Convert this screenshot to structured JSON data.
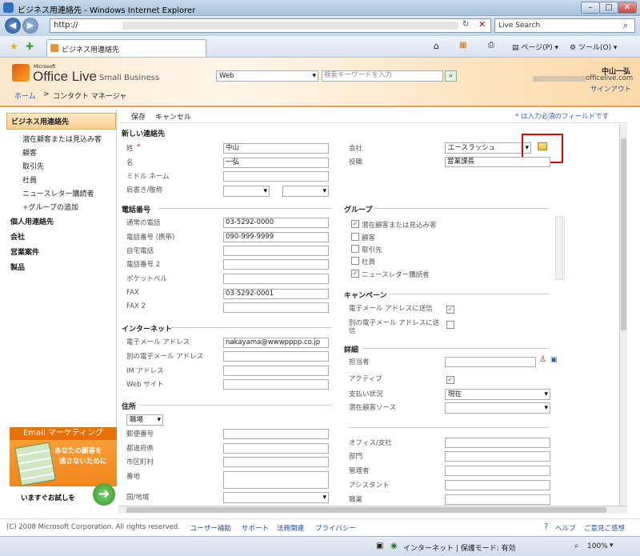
{
  "window": {
    "title": "ビジネス用連絡先 - Windows Internet Explorer"
  },
  "address": {
    "url": "http://",
    "search_placeholder": "Live Search"
  },
  "tab": {
    "title": "ビジネス用連絡先"
  },
  "cmd": {
    "page": "ページ(P)",
    "tools": "ツール(O)"
  },
  "header": {
    "logo_ms": "Microsoft",
    "logo_ol": "Office Live",
    "logo_sb": "Small Business",
    "search_scope": "Web",
    "search_placeholder": "検索キーワードを入力",
    "user": "中山一弘",
    "user_domain": "officelive.com",
    "signout": "サインアウト"
  },
  "breadcrumb": {
    "home": "ホーム",
    "sep": ">",
    "current": "コンタクト マネージャ"
  },
  "sidebar": {
    "section1": "ビジネス用連絡先",
    "items": [
      "潜在顧客または見込み客",
      "顧客",
      "取引先",
      "社員",
      "ニュースレター購読者"
    ],
    "add_group": "グループの追加",
    "section2": "個人用連絡先",
    "section3": "会社",
    "section4": "営業案件",
    "section5": "製品"
  },
  "promo": {
    "title": "Email マーケティング",
    "line1": "あなたの顧客を",
    "line2": "逃さないために",
    "cta": "いますぐお試しを"
  },
  "toolbar": {
    "save": "保存",
    "cancel": "キャンセル",
    "required_note": "* は入力必須のフィールドです"
  },
  "form": {
    "new_contact": "新しい連絡先",
    "last_name_label": "姓",
    "required_mark": "*",
    "last_name": "中山",
    "first_name_label": "名",
    "first_name": "一弘",
    "middle_name_label": "ミドル ネーム",
    "title_label": "肩書き/敬称",
    "company_label": "会社",
    "company": "エースラッシュ",
    "position_label": "役職",
    "position": "営業課長",
    "phone_section": "電話番号",
    "work_phone_label": "通常の電話",
    "work_phone": "03-5292-0000",
    "mobile_label": "電話番号 (携帯)",
    "mobile": "090-999-9999",
    "home_phone_label": "自宅電話",
    "phone2_label": "電話番号 2",
    "pager_label": "ポケットベル",
    "fax_label": "FAX",
    "fax": "03-5292-0001",
    "fax2_label": "FAX 2",
    "internet_section": "インターネット",
    "email_label": "電子メール アドレス",
    "email": "nakayama@wwwpppp.co.jp",
    "email2_label": "別の電子メール アドレス",
    "im_label": "IM アドレス",
    "web_label": "Web サイト",
    "address_section": "住所",
    "address_type": "職場",
    "zip_label": "郵便番号",
    "pref_label": "都道府県",
    "city_label": "市区町村",
    "street_label": "番地",
    "country_label": "国/地域",
    "group_section": "グループ",
    "groups": [
      {
        "label": "潜在顧客または見込み客",
        "checked": true
      },
      {
        "label": "顧客",
        "checked": false
      },
      {
        "label": "取引先",
        "checked": false
      },
      {
        "label": "社員",
        "checked": false
      },
      {
        "label": "ニュースレター購読者",
        "checked": true
      }
    ],
    "campaign_section": "キャンペーン",
    "send_email_label": "電子メール アドレスに送信",
    "send_email2_label_1": "別の電子メール アドレスに送",
    "send_email2_label_2": "信",
    "detail_section": "詳細",
    "owner_label": "担当者",
    "active_label": "アクティブ",
    "payment_label": "支払い状況",
    "payment": "現在",
    "source_label": "潜在顧客ソース",
    "office_label": "オフィス/支社",
    "dept_label": "部門",
    "manager_label": "管理者",
    "assistant_label": "アシスタント",
    "job_label": "職業"
  },
  "footer": {
    "copyright": "(C) 2008 Microsoft Corporation. All rights reserved.",
    "links": [
      "ユーザー補助",
      "サポート",
      "法務関連",
      "プライバシー"
    ],
    "help": "ヘルプ",
    "feedback": "ご意見ご感想"
  },
  "status": {
    "zone": "インターネット | 保護モード: 有効",
    "zoom": "100%"
  },
  "colors": {
    "accent": "#f07b10",
    "highlight_box": "#e00000"
  }
}
